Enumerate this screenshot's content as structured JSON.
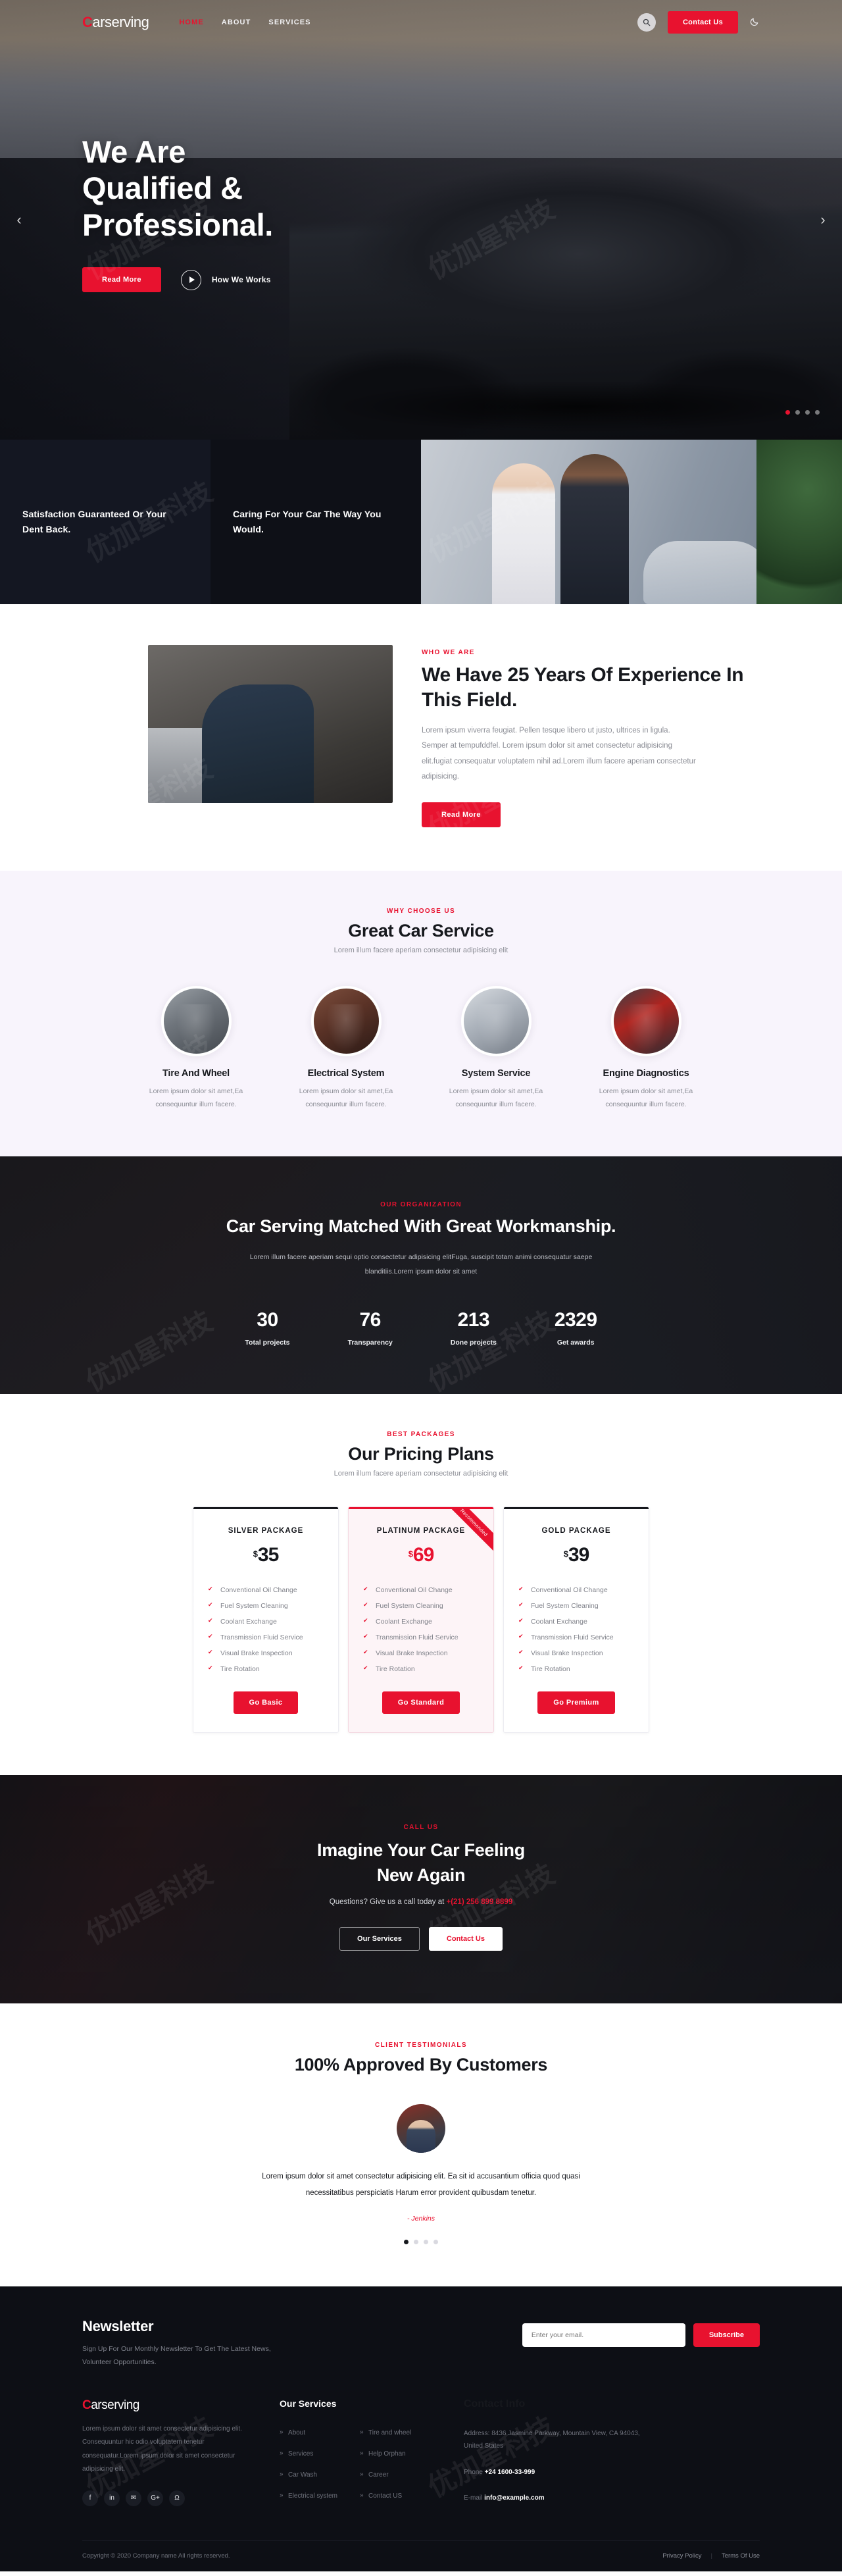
{
  "brand": {
    "name_first": "C",
    "name_rest": "arserving",
    "accent": "#e8122f"
  },
  "header": {
    "nav": [
      {
        "label": "HOME",
        "active": true
      },
      {
        "label": "ABOUT",
        "active": false
      },
      {
        "label": "SERVICES",
        "active": false
      }
    ],
    "search_icon": "search-icon",
    "contact_button": "Contact Us",
    "mode_icon": "moon-icon"
  },
  "hero": {
    "title_line1": "We Are",
    "title_line2": "Qualified &",
    "title_line3": "Professional.",
    "primary_button": "Read More",
    "video_label": "How We Works",
    "prev_icon": "chevron-left-icon",
    "next_icon": "chevron-right-icon",
    "dots": 4,
    "active_dot": 0
  },
  "features": [
    {
      "title": "Satisfaction Guaranteed Or Your Dent Back."
    },
    {
      "title": "Caring For Your Car The Way You Would."
    }
  ],
  "about": {
    "eyebrow": "WHO WE ARE",
    "title": "We Have 25 Years Of Experience In This Field.",
    "body": "Lorem ipsum viverra feugiat. Pellen tesque libero ut justo, ultrices in ligula. Semper at tempufddfel. Lorem ipsum dolor sit amet consectetur adipisicing elit.fugiat consequatur voluptatem nihil ad.Lorem illum facere aperiam consectetur adipisicing.",
    "button": "Read More"
  },
  "why": {
    "eyebrow": "WHY CHOOSE US",
    "title": "Great Car Service",
    "subtitle": "Lorem illum facere aperiam consectetur adipisicing elit",
    "items": [
      {
        "title": "Tire And Wheel",
        "text": "Lorem ipsum dolor sit amet,Ea consequuntur illum facere."
      },
      {
        "title": "Electrical System",
        "text": "Lorem ipsum dolor sit amet,Ea consequuntur illum facere."
      },
      {
        "title": "System Service",
        "text": "Lorem ipsum dolor sit amet,Ea consequuntur illum facere."
      },
      {
        "title": "Engine Diagnostics",
        "text": "Lorem ipsum dolor sit amet,Ea consequuntur illum facere."
      }
    ]
  },
  "counter": {
    "eyebrow": "OUR ORGANIZATION",
    "title": "Car Serving Matched With Great Workmanship.",
    "text": "Lorem illum facere aperiam sequi optio consectetur adipisicing elitFuga, suscipit totam animi consequatur saepe blanditiis.Lorem ipsum dolor sit amet",
    "stats": [
      {
        "value": "30",
        "label": "Total projects"
      },
      {
        "value": "76",
        "label": "Transparency"
      },
      {
        "value": "213",
        "label": "Done projects"
      },
      {
        "value": "2329",
        "label": "Get awards"
      }
    ]
  },
  "pricing": {
    "eyebrow": "BEST PACKAGES",
    "title": "Our Pricing Plans",
    "subtitle": "Lorem illum facere aperiam consectetur adipisicing elit",
    "ribbon_label": "Recommended",
    "currency": "$",
    "plans": [
      {
        "name": "SILVER PACKAGE",
        "price": "35",
        "featured": false,
        "features": [
          "Conventional Oil Change",
          "Fuel System Cleaning",
          "Coolant Exchange",
          "Transmission Fluid Service",
          "Visual Brake Inspection",
          "Tire Rotation"
        ],
        "button": "Go Basic"
      },
      {
        "name": "PLATINUM PACKAGE",
        "price": "69",
        "featured": true,
        "features": [
          "Conventional Oil Change",
          "Fuel System Cleaning",
          "Coolant Exchange",
          "Transmission Fluid Service",
          "Visual Brake Inspection",
          "Tire Rotation"
        ],
        "button": "Go Standard"
      },
      {
        "name": "GOLD PACKAGE",
        "price": "39",
        "featured": false,
        "features": [
          "Conventional Oil Change",
          "Fuel System Cleaning",
          "Coolant Exchange",
          "Transmission Fluid Service",
          "Visual Brake Inspection",
          "Tire Rotation"
        ],
        "button": "Go Premium"
      }
    ]
  },
  "cta": {
    "eyebrow": "CALL US",
    "title_line1": "Imagine Your Car Feeling",
    "title_line2": "New Again",
    "question_prefix": "Questions? Give us a call today at ",
    "phone": "+(21) 256 899 8899",
    "button_secondary": "Our Services",
    "button_primary": "Contact Us"
  },
  "testimonial": {
    "eyebrow": "CLIENT TESTIMONIALS",
    "title": "100% Approved By Customers",
    "quote": "Lorem ipsum dolor sit amet consectetur adipisicing elit. Ea sit id accusantium officia quod quasi necessitatibus perspiciatis Harum error provident quibusdam tenetur.",
    "author": "- Jenkins",
    "dots": 4,
    "active_dot": 0
  },
  "newsletter": {
    "title": "Newsletter",
    "text": "Sign Up For Our Monthly Newsletter To Get The Latest News, Volunteer Opportunities.",
    "input_placeholder": "Enter your email.",
    "button": "Subscribe"
  },
  "footer": {
    "about_text": "Lorem ipsum dolor sit amet consectetur adipisicing elit. Consequuntur hic odio voluptatem tenetur consequatur.Lorem ipsum dolor sit amet consectetur adipisicing elit.",
    "socials": [
      {
        "icon": "facebook-icon",
        "glyph": "f"
      },
      {
        "icon": "linkedin-icon",
        "glyph": "in"
      },
      {
        "icon": "twitter-icon",
        "glyph": "✉"
      },
      {
        "icon": "google-plus-icon",
        "glyph": "G+"
      },
      {
        "icon": "github-icon",
        "glyph": "Ω"
      }
    ],
    "services_title": "Our Services",
    "services_col1": [
      "About",
      "Services",
      "Car Wash",
      "Electrical system"
    ],
    "services_col2": [
      "Tire and wheel",
      "Help Orphan",
      "Career",
      "Contact US"
    ],
    "contact_title": "Contact Info",
    "address": "Address: 8436 Jasmine Parkway, Mountain View, CA 94043, United States",
    "phone_label": "Phone",
    "phone_value": "+24 1600-33-999",
    "email_label": "E-mail",
    "email_value": "info@example.com",
    "copyright": "Copyright © 2020 Company name All rights reserved.",
    "privacy": "Privacy Policy",
    "terms": "Terms Of Use"
  }
}
